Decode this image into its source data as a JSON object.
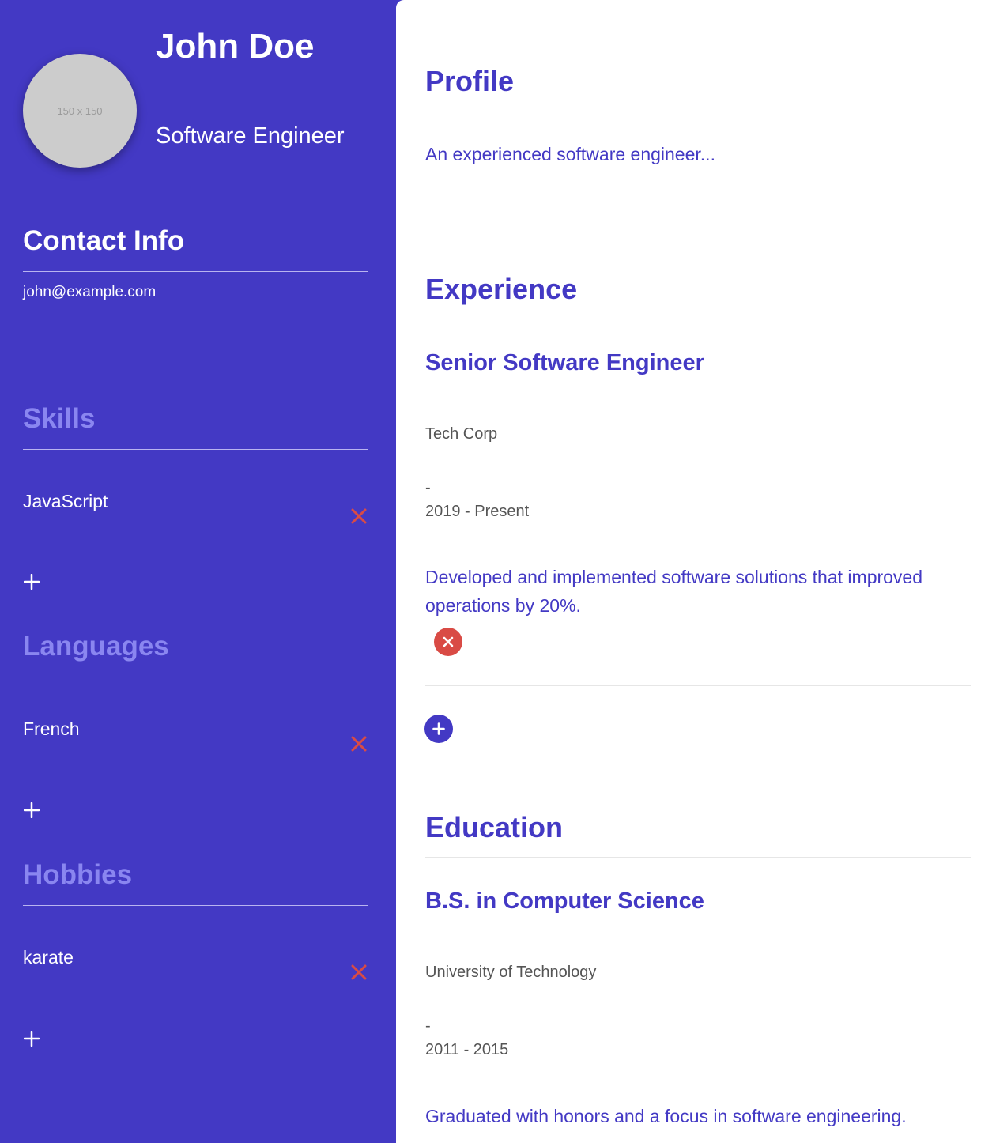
{
  "profile": {
    "name": "John Doe",
    "title": "Software Engineer",
    "avatar_placeholder": "150 x 150"
  },
  "sidebar": {
    "contact": {
      "heading": "Contact Info",
      "email": "john@example.com"
    },
    "skills": {
      "heading": "Skills",
      "items": [
        "JavaScript"
      ]
    },
    "languages": {
      "heading": "Languages",
      "items": [
        "French"
      ]
    },
    "hobbies": {
      "heading": "Hobbies",
      "items": [
        "karate"
      ]
    }
  },
  "main": {
    "profile": {
      "heading": "Profile",
      "summary": "An experienced software engineer..."
    },
    "experience": {
      "heading": "Experience",
      "items": [
        {
          "role": "Senior Software Engineer",
          "company": "Tech Corp",
          "separator": "-",
          "dates": "2019 - Present",
          "description": "Developed and implemented software solutions that improved operations by 20%."
        }
      ]
    },
    "education": {
      "heading": "Education",
      "items": [
        {
          "degree": "B.S. in Computer Science",
          "school": "University of Technology",
          "separator": "-",
          "dates": "2011 - 2015",
          "description": "Graduated with honors and a focus in software engineering."
        }
      ]
    }
  },
  "colors": {
    "brand": "#4339c4",
    "muted_heading": "#8a86f0",
    "remove": "#d94b45",
    "white": "#ffffff"
  },
  "icons": {
    "remove": "close-icon",
    "add": "plus-icon"
  }
}
